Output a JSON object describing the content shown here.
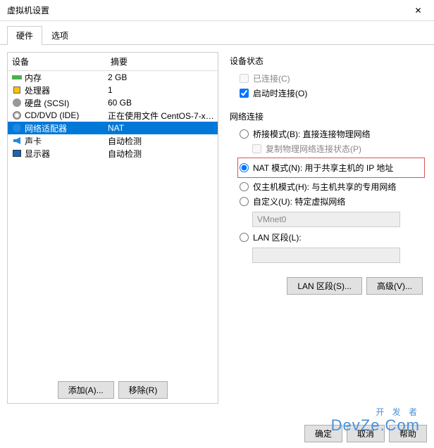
{
  "window": {
    "title": "虚拟机设置"
  },
  "tabs": {
    "hardware": "硬件",
    "options": "选项"
  },
  "table": {
    "header_device": "设备",
    "header_summary": "摘要",
    "rows": [
      {
        "name": "内存",
        "summary": "2 GB",
        "icon": "memory"
      },
      {
        "name": "处理器",
        "summary": "1",
        "icon": "cpu"
      },
      {
        "name": "硬盘 (SCSI)",
        "summary": "60 GB",
        "icon": "disk"
      },
      {
        "name": "CD/DVD (IDE)",
        "summary": "正在使用文件 CentOS-7-x86...",
        "icon": "cd"
      },
      {
        "name": "网络适配器",
        "summary": "NAT",
        "icon": "network"
      },
      {
        "name": "声卡",
        "summary": "自动检测",
        "icon": "sound"
      },
      {
        "name": "显示器",
        "summary": "自动检测",
        "icon": "display"
      }
    ]
  },
  "buttons": {
    "add": "添加(A)...",
    "remove": "移除(R)",
    "ok": "确定",
    "cancel": "取消",
    "help": "帮助",
    "lan_segment": "LAN 区段(S)...",
    "advanced": "高级(V)..."
  },
  "device_status": {
    "title": "设备状态",
    "connected": "已连接(C)",
    "connect_at_power": "启动时连接(O)"
  },
  "network": {
    "title": "网络连接",
    "bridge": "桥接模式(B): 直接连接物理网络",
    "replicate": "复制物理网络连接状态(P)",
    "nat": "NAT 模式(N): 用于共享主机的 IP 地址",
    "hostonly": "仅主机模式(H): 与主机共享的专用网络",
    "custom": "自定义(U): 特定虚拟网络",
    "custom_value": "VMnet0",
    "lan": "LAN 区段(L):"
  },
  "watermark": {
    "line1": "开 发 者",
    "line2": "DevZe.Com"
  }
}
